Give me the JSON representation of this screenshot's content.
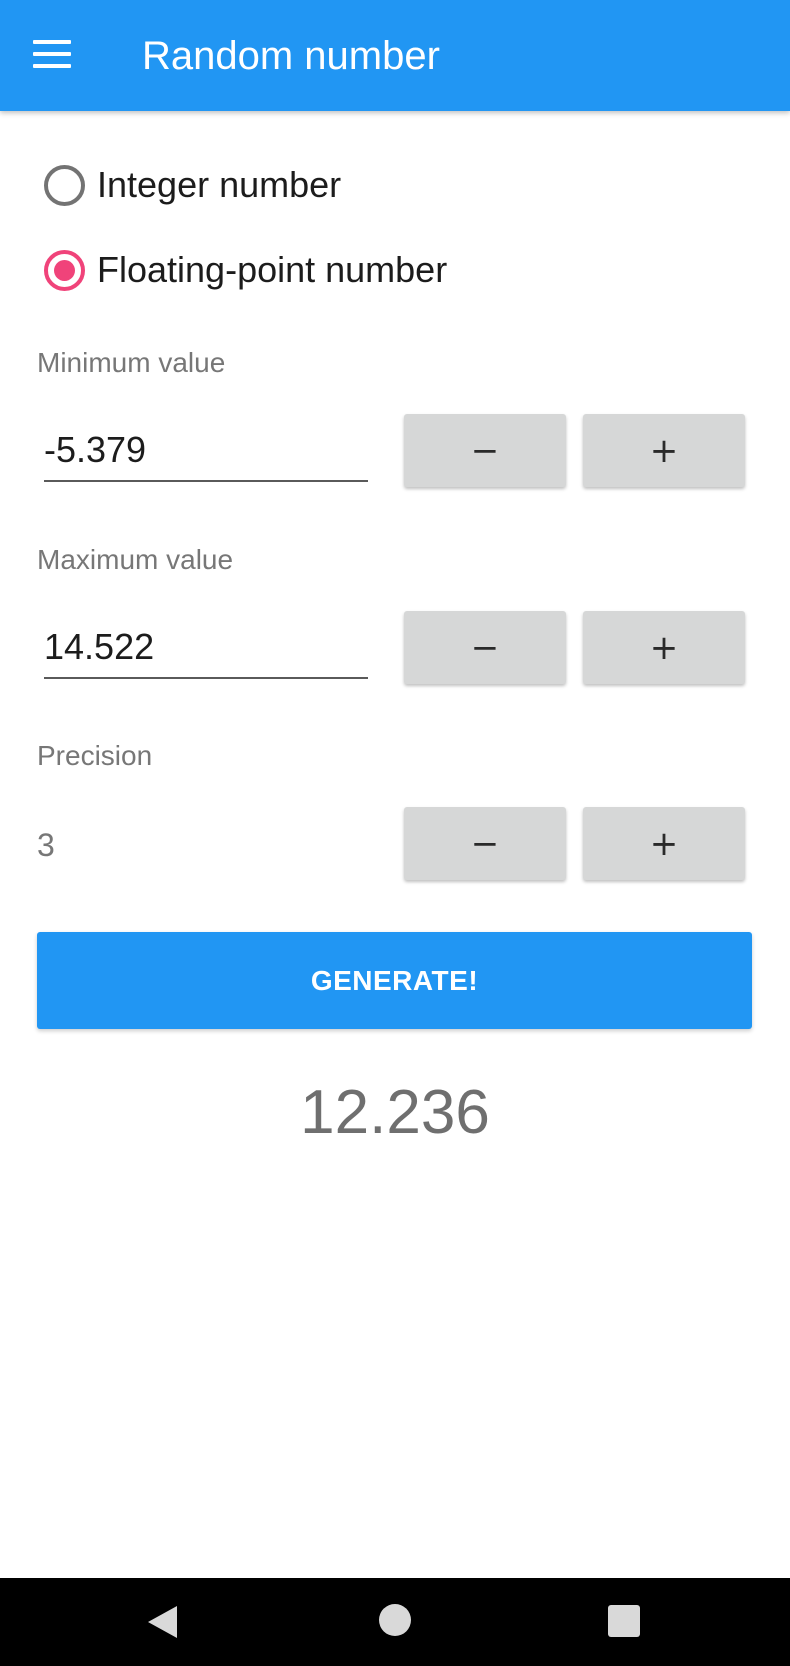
{
  "appbar": {
    "title": "Random number",
    "menu_icon": "hamburger-menu-icon"
  },
  "number_type": {
    "options": [
      {
        "label": "Integer number",
        "selected": false
      },
      {
        "label": "Floating-point number",
        "selected": true
      }
    ]
  },
  "minimum": {
    "label": "Minimum value",
    "value": "-5.379",
    "decrement_label": "−",
    "increment_label": "+"
  },
  "maximum": {
    "label": "Maximum value",
    "value": "14.522",
    "decrement_label": "−",
    "increment_label": "+"
  },
  "precision": {
    "label": "Precision",
    "value": "3",
    "decrement_label": "−",
    "increment_label": "+"
  },
  "generate_label": "GENERATE!",
  "result": "12.236",
  "colors": {
    "accent": "#2196F3",
    "radio_selected": "#F0437A",
    "stepper_bg": "#D6D7D7"
  },
  "navbar": {
    "icons": [
      "back-icon",
      "home-icon",
      "recent-apps-icon"
    ]
  }
}
